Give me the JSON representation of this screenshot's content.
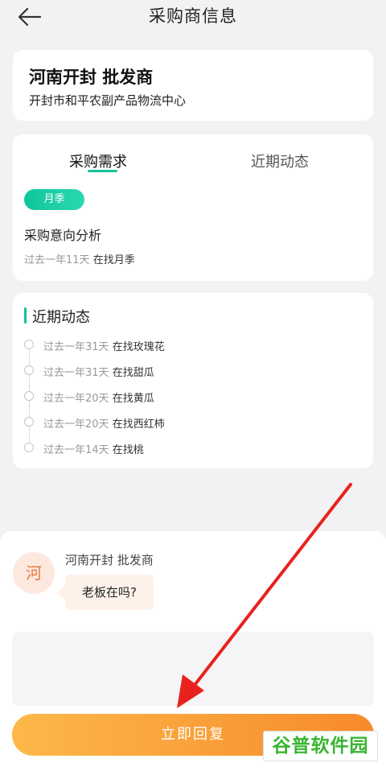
{
  "header": {
    "title": "采购商信息",
    "back_icon": "back-arrow-icon"
  },
  "buyer": {
    "name": "河南开封 批发商",
    "address": "开封市和平农副产品物流中心"
  },
  "tabs": [
    {
      "label": "采购需求",
      "active": true
    },
    {
      "label": "近期动态",
      "active": false
    }
  ],
  "demand": {
    "tag": "月季",
    "section_title": "采购意向分析",
    "time": "过去一年11天",
    "text": "在找月季"
  },
  "recent": {
    "title": "近期动态",
    "items": [
      {
        "time": "过去一年31天",
        "text": "在找玫瑰花"
      },
      {
        "time": "过去一年31天",
        "text": "在找甜瓜"
      },
      {
        "time": "过去一年20天",
        "text": "在找黄瓜"
      },
      {
        "time": "过去一年20天",
        "text": "在找西红柿"
      },
      {
        "time": "过去一年14天",
        "text": "在找桃"
      }
    ]
  },
  "chat": {
    "avatar_char": "河",
    "sender": "河南开封 批发商",
    "message": "老板在吗?"
  },
  "reply": {
    "input_value": "",
    "button_label": "立即回复"
  },
  "watermark": {
    "text": "谷普软件园"
  },
  "colors": {
    "accent_green": "#13c39a",
    "button_orange_start": "#fcb84a",
    "button_orange_end": "#f78a2c",
    "annotation_red": "#e8221f"
  }
}
